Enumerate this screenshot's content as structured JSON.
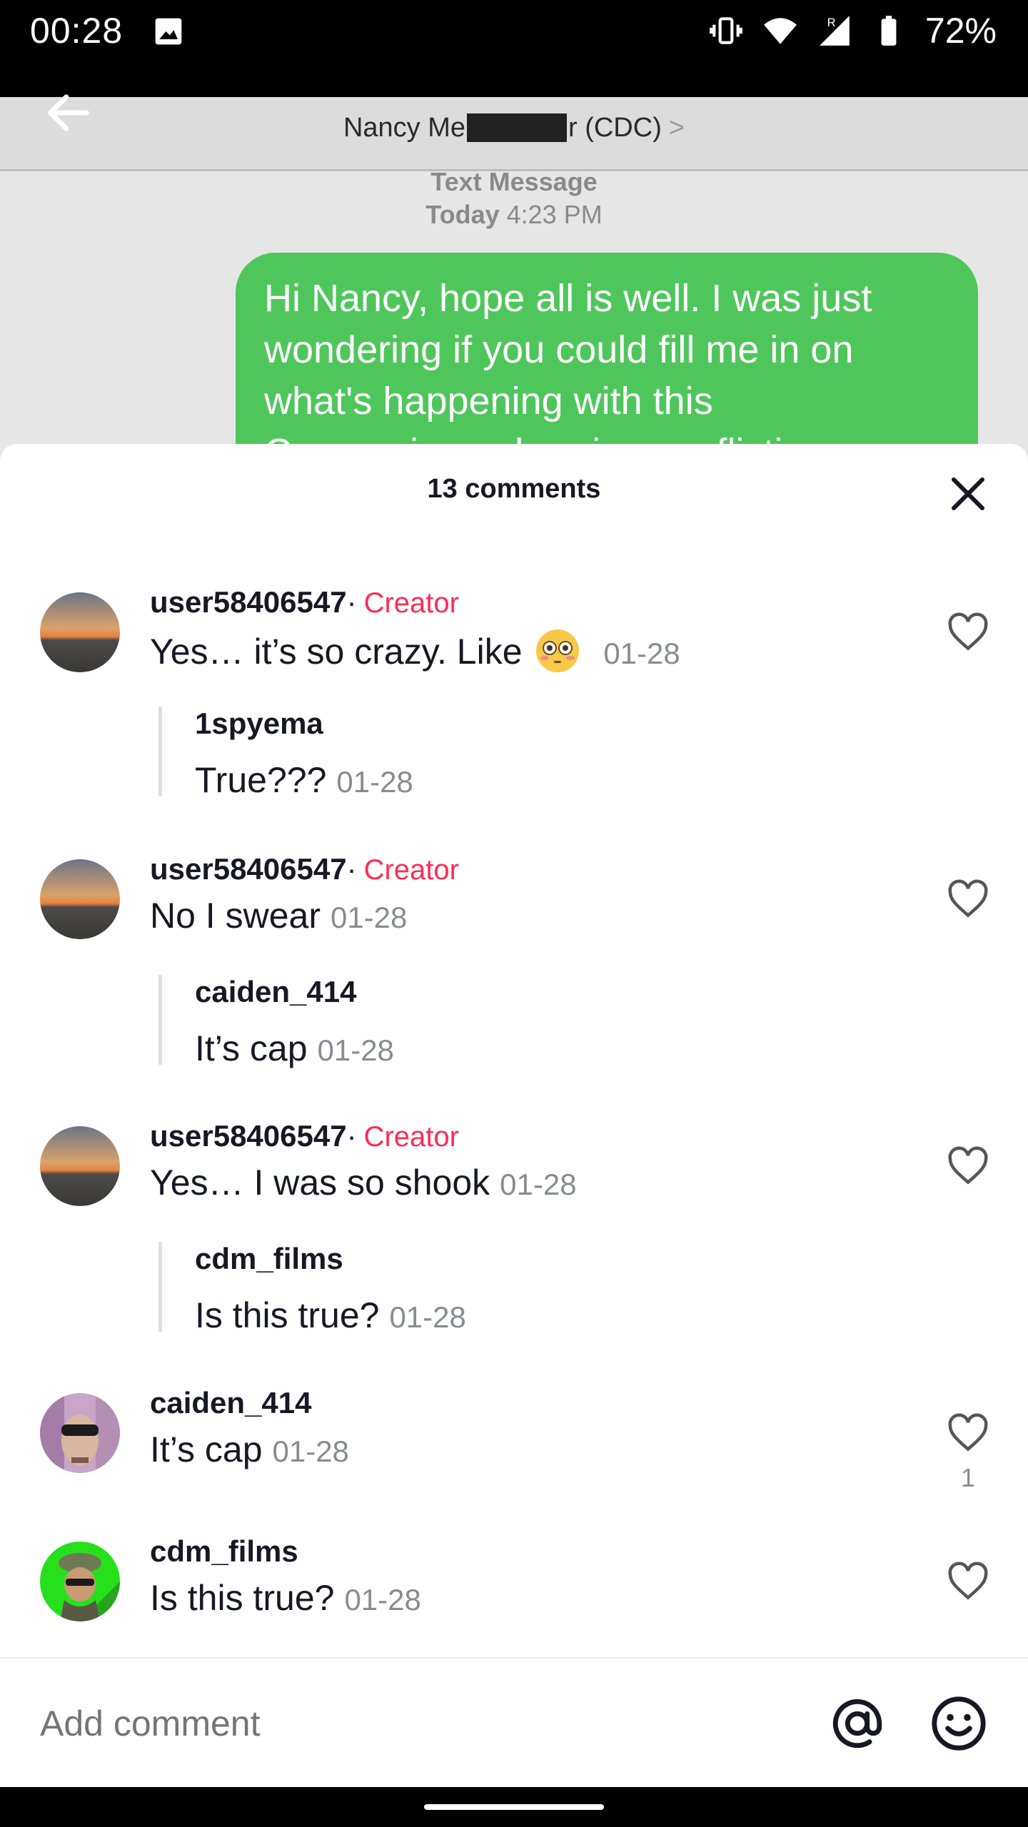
{
  "status_bar": {
    "time": "00:28",
    "battery": "72%",
    "icons": [
      "image-icon",
      "vibrate-icon",
      "wifi-icon",
      "signal-icon",
      "battery-icon"
    ]
  },
  "video": {
    "contact_pre": "Nancy Me",
    "contact_post": "r (CDC)",
    "contact_chevron": ">",
    "meta_line1": "Text Message",
    "meta_line2_day": "Today",
    "meta_line2_time": "4:23 PM",
    "bubble_text": "Hi Nancy, hope all is well. I was just wondering if you could fill me in on what's happening with this Coronavirus... hearing conflicting"
  },
  "sheet": {
    "title": "13 comments"
  },
  "comments": [
    {
      "user": "user58406547",
      "badge_sep": "·",
      "badge": "Creator",
      "text_before": "Yes… it’s so crazy. Like",
      "emoji": "flushed-face",
      "date": "01-28",
      "reply": {
        "user": "1spyema",
        "text": "True???",
        "date": "01-28"
      }
    },
    {
      "user": "user58406547",
      "badge_sep": "·",
      "badge": "Creator",
      "text": "No I swear",
      "date": "01-28",
      "reply": {
        "user": "caiden_414",
        "text": "It’s cap",
        "date": "01-28"
      }
    },
    {
      "user": "user58406547",
      "badge_sep": "·",
      "badge": "Creator",
      "text": "Yes… I was so shook",
      "date": "01-28",
      "reply": {
        "user": "cdm_films",
        "text": "Is this true?",
        "date": "01-28"
      }
    },
    {
      "user": "caiden_414",
      "text": "It’s cap",
      "date": "01-28",
      "likes": "1"
    },
    {
      "user": "cdm_films",
      "text": "Is this true?",
      "date": "01-28"
    }
  ],
  "input": {
    "placeholder": "Add comment"
  },
  "colors": {
    "creator": "#fe2c55",
    "bubble": "#4fc65c",
    "muted": "#8a8b91",
    "text": "#161823"
  }
}
